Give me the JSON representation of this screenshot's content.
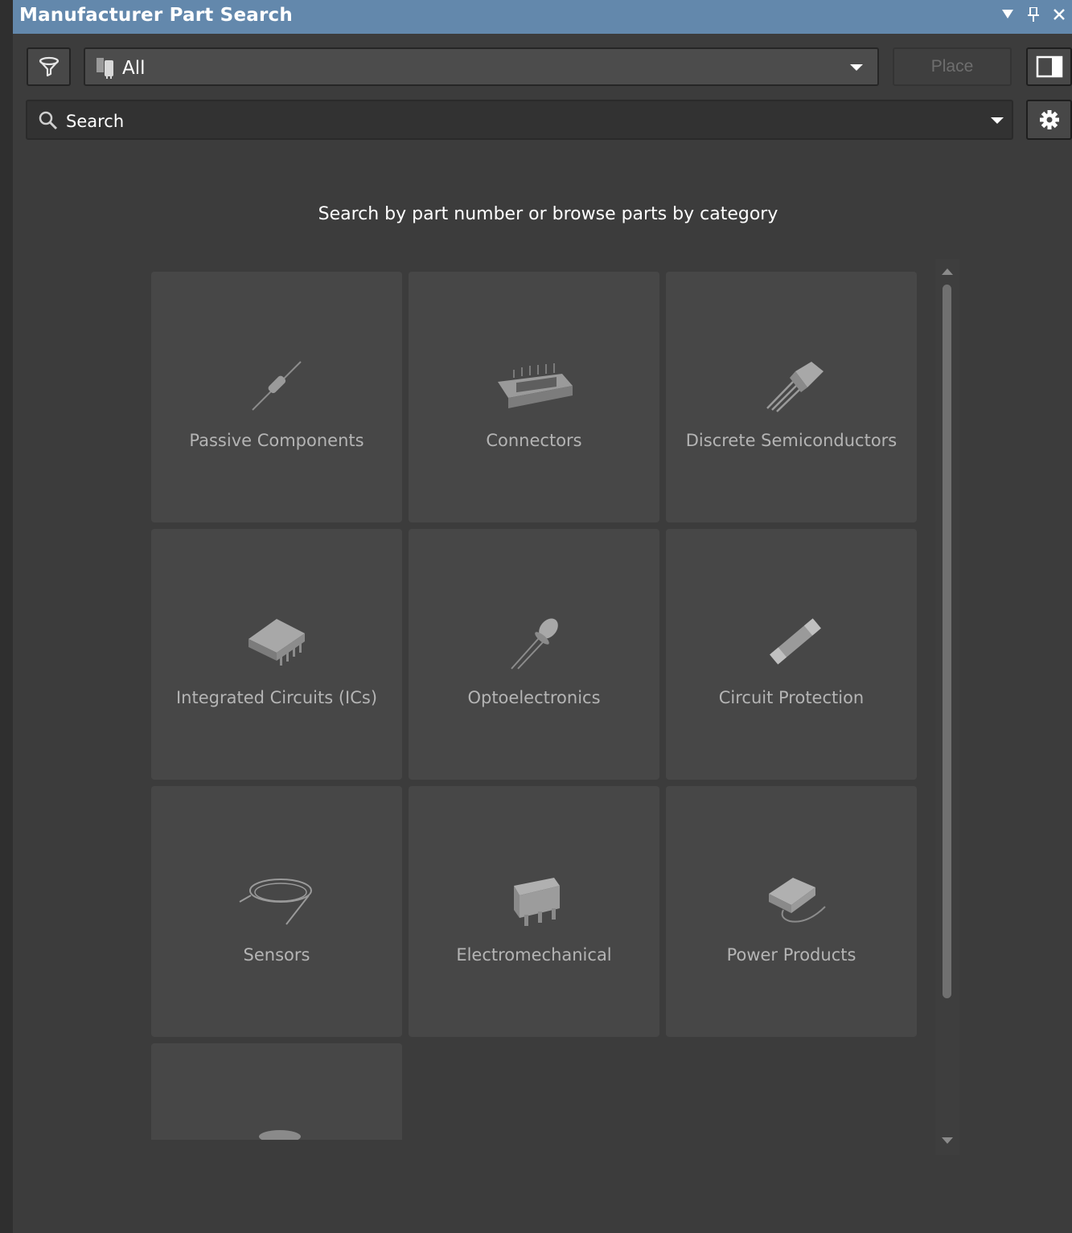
{
  "window": {
    "title": "Manufacturer Part Search",
    "icons": [
      "dropdown-arrow-icon",
      "pin-icon",
      "close-icon"
    ]
  },
  "toolbar": {
    "source_value": "All",
    "place_label": "Place"
  },
  "search": {
    "placeholder": "Search"
  },
  "main": {
    "hint": "Search by part number or browse parts by category"
  },
  "categories": [
    {
      "label": "Passive Components",
      "icon": "resistor-icon"
    },
    {
      "label": "Connectors",
      "icon": "connector-icon"
    },
    {
      "label": "Discrete Semiconductors",
      "icon": "transistor-icon"
    },
    {
      "label": "Integrated Circuits (ICs)",
      "icon": "ic-chip-icon"
    },
    {
      "label": "Optoelectronics",
      "icon": "led-icon"
    },
    {
      "label": "Circuit Protection",
      "icon": "fuse-icon"
    },
    {
      "label": "Sensors",
      "icon": "sensor-wire-icon"
    },
    {
      "label": "Electromechanical",
      "icon": "switch-icon"
    },
    {
      "label": "Power Products",
      "icon": "power-adapter-icon"
    },
    {
      "label": "",
      "icon": "more-category-icon"
    }
  ],
  "colors": {
    "titlebar": "#6388ac",
    "background": "#3c3c3c",
    "tile": "#474747",
    "tile_text": "#b4b4b4"
  }
}
